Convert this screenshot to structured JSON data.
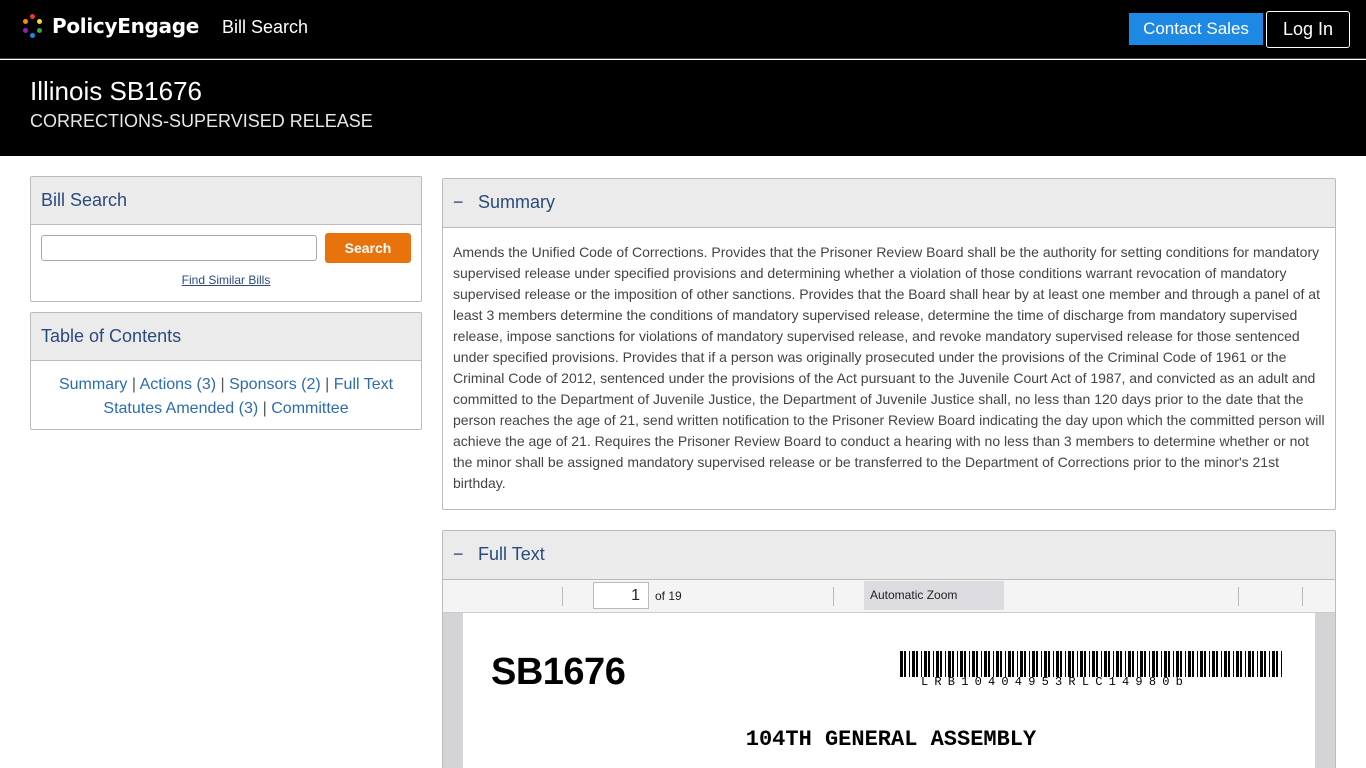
{
  "nav": {
    "brand": "PolicyEngage",
    "bill_search_link": "Bill Search",
    "contact_sales": "Contact Sales",
    "login": "Log In"
  },
  "bill": {
    "title": "Illinois SB1676",
    "subtitle": "CORRECTIONS-SUPERVISED RELEASE"
  },
  "search_panel": {
    "heading": "Bill Search",
    "input_value": "",
    "button": "Search",
    "find_similar": "Find Similar Bills"
  },
  "toc": {
    "heading": "Table of Contents",
    "separator": "|",
    "links": [
      "Summary",
      "Actions (3)",
      "Sponsors (2)",
      "Full Text",
      "Statutes Amended (3)",
      "Committee"
    ]
  },
  "summary": {
    "toggle": "−",
    "heading": "Summary",
    "text": "Amends the Unified Code of Corrections. Provides that the Prisoner Review Board shall be the authority for setting conditions for mandatory supervised release under specified provisions and determining whether a violation of those conditions warrant revocation of mandatory supervised release or the imposition of other sanctions. Provides that the Board shall hear by at least one member and through a panel of at least 3 members determine the conditions of mandatory supervised release, determine the time of discharge from mandatory supervised release, impose sanctions for violations of mandatory supervised release, and revoke mandatory supervised release for those sentenced under specified provisions. Provides that if a person was originally prosecuted under the provisions of the Criminal Code of 1961 or the Criminal Code of 2012, sentenced under the provisions of the Act pursuant to the Juvenile Court Act of 1987, and convicted as an adult and committed to the Department of Juvenile Justice, the Department of Juvenile Justice shall, no less than 120 days prior to the date that the person reaches the age of 21, send written notification to the Prisoner Review Board indicating the day upon which the committed person will achieve the age of 21. Requires the Prisoner Review Board to conduct a hearing with no less than 3 members to determine whether or not the minor shall be assigned mandatory supervised release or be transferred to the Department of Corrections prior to the minor's 21st birthday."
  },
  "full_text": {
    "toggle": "−",
    "heading": "Full Text",
    "current_page": "1",
    "page_count_label": "of 19",
    "zoom": "Automatic Zoom",
    "doc_bill_number": "SB1676",
    "barcode_text": "LRB10404953RLC14980b",
    "assembly": "104TH GENERAL ASSEMBLY"
  },
  "colors": {
    "accent_blue": "#1e88e5",
    "search_orange": "#e8730c",
    "heading_navy": "#2b4a7c",
    "link_blue": "#2b6cb0"
  }
}
